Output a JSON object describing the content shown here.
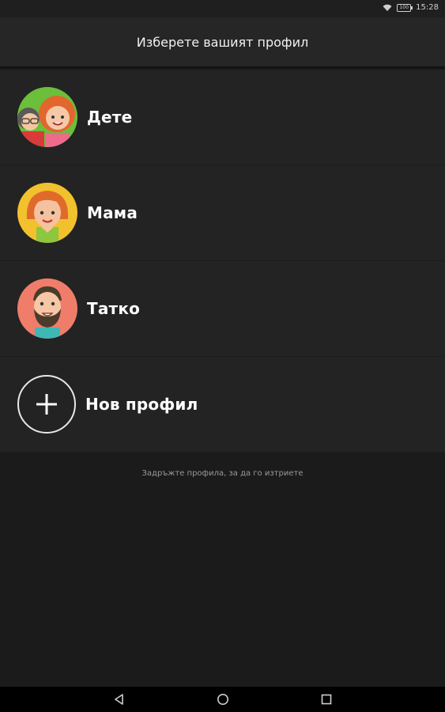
{
  "status_bar": {
    "time": "15:28",
    "battery": "100"
  },
  "header": {
    "title": "Изберете вашият профил"
  },
  "profiles": [
    {
      "label": "Дете"
    },
    {
      "label": "Мама"
    },
    {
      "label": "Татко"
    }
  ],
  "new_profile": {
    "label": "Нов профил"
  },
  "hint": {
    "text": "Задръжте профила, за да го изтриете"
  },
  "icons": {
    "back": "back-triangle-icon",
    "home": "home-circle-icon",
    "recents": "recents-square-icon",
    "add": "plus-icon"
  },
  "colors": {
    "background": "#1b1b1b",
    "header": "#262626",
    "list": "#232323",
    "mom_avatar_bg": "#f2c12e",
    "dad_avatar_bg": "#f07d6a",
    "kid_avatar_bg": "#6bbf3a"
  }
}
